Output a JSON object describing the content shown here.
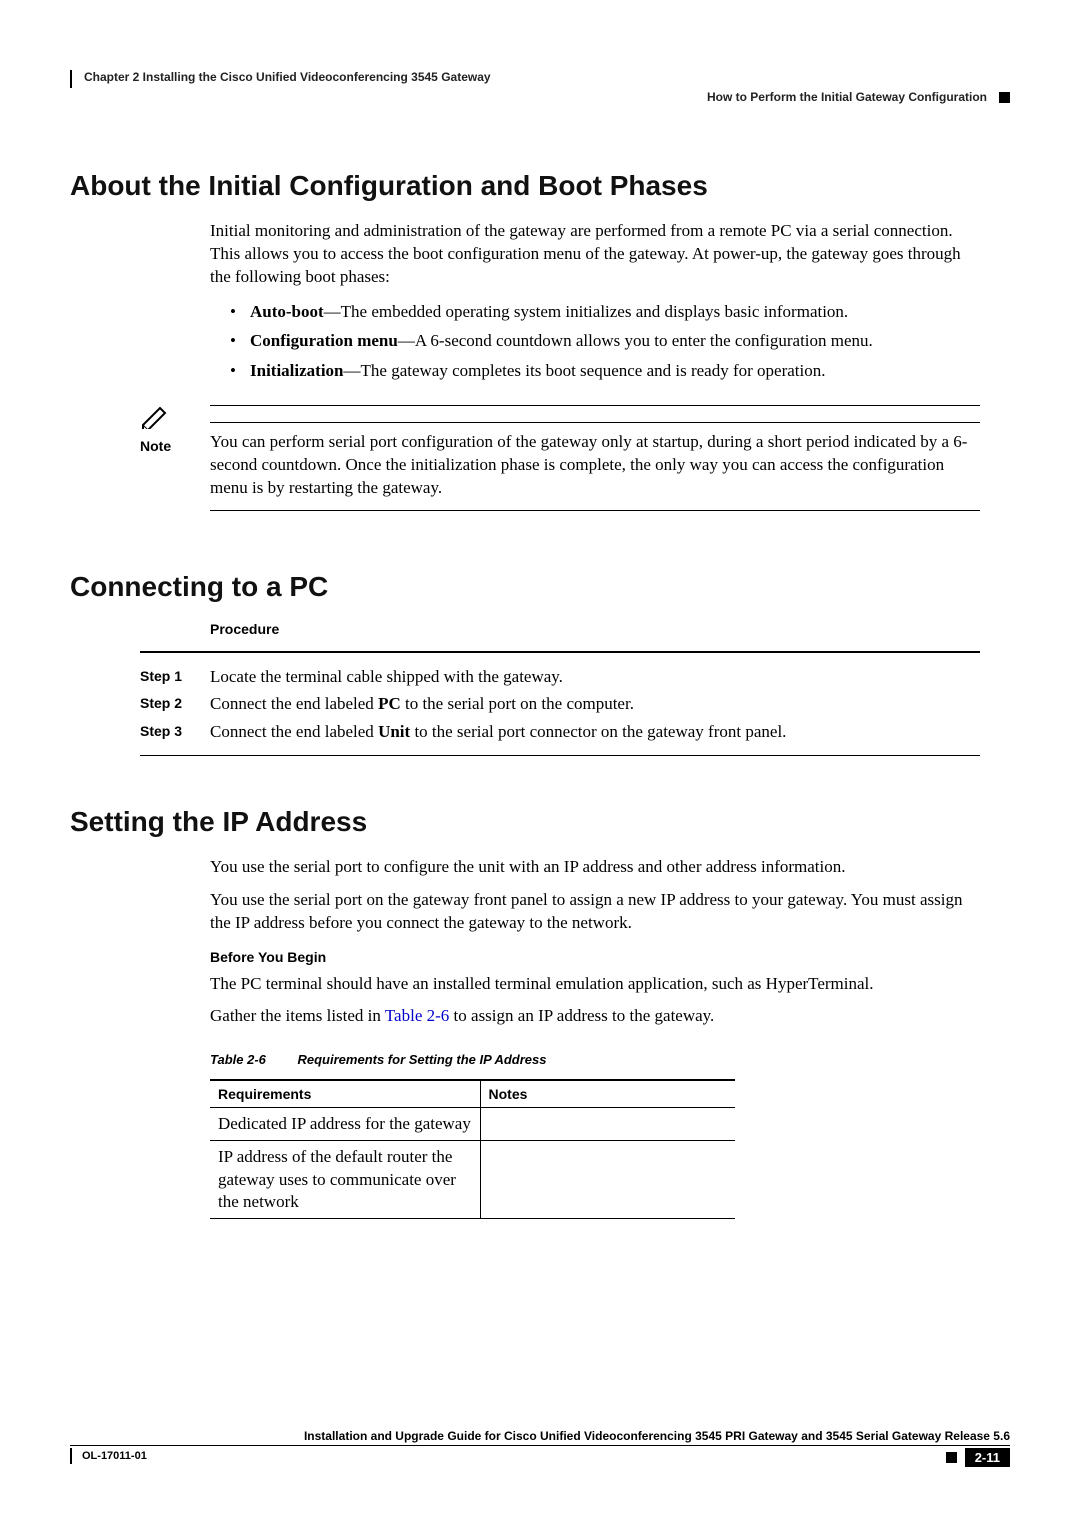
{
  "header": {
    "chapter_line": "Chapter 2      Installing the Cisco Unified Videoconferencing 3545 Gateway",
    "section_line": "How to Perform the Initial Gateway Configuration"
  },
  "sections": {
    "s1_title": "About the Initial Configuration and Boot Phases",
    "s1_intro": "Initial monitoring and administration of the gateway are performed from a remote PC via a serial connection. This allows you to access the boot configuration menu of the gateway. At power-up, the gateway goes through the following boot phases:",
    "s1_bullets": [
      {
        "bold": "Auto-boot",
        "rest": "—The embedded operating system initializes and displays basic information."
      },
      {
        "bold": "Configuration menu",
        "rest": "—A 6-second countdown allows you to enter the configuration menu."
      },
      {
        "bold": "Initialization",
        "rest": "—The gateway completes its boot sequence and is ready for operation."
      }
    ],
    "note_label": "Note",
    "note_text": "You can perform serial port configuration of the gateway only at startup, during a short period indicated by a 6-second countdown. Once the initialization phase is complete, the only way you can access the configuration menu is by restarting the gateway.",
    "s2_title": "Connecting to a PC",
    "procedure_label": "Procedure",
    "steps": [
      {
        "num": "Step 1",
        "pre": "Locate the terminal cable shipped with the gateway.",
        "bold": "",
        "post": ""
      },
      {
        "num": "Step 2",
        "pre": "Connect the end labeled ",
        "bold": "PC",
        "post": " to the serial port on the computer."
      },
      {
        "num": "Step 3",
        "pre": "Connect the end labeled ",
        "bold": "Unit",
        "post": " to the serial port connector on the gateway front panel."
      }
    ],
    "s3_title": "Setting the IP Address",
    "s3_p1": "You use the serial port to configure the unit with an IP address and other address information.",
    "s3_p2": "You use the serial port on the gateway front panel to assign a new IP address to your gateway. You must assign the IP address before you connect the gateway to the network.",
    "before_label": "Before You Begin",
    "s3_p3": "The PC terminal should have an installed terminal emulation application, such as HyperTerminal.",
    "s3_p4_pre": "Gather the items listed in ",
    "s3_p4_link": "Table 2-6",
    "s3_p4_post": " to assign an IP address to the gateway.",
    "table_caption_id": "Table 2-6",
    "table_caption_title": "Requirements for Setting the IP Address",
    "table_h1": "Requirements",
    "table_h2": "Notes",
    "table_rows": [
      "Dedicated IP address for the gateway",
      "IP address of the default router the gateway uses to communicate over the network"
    ]
  },
  "footer": {
    "doc_title": "Installation and Upgrade Guide for Cisco Unified Videoconferencing 3545 PRI Gateway and 3545 Serial Gateway Release 5.6",
    "doc_id": "OL-17011-01",
    "page_num": "2-11"
  }
}
